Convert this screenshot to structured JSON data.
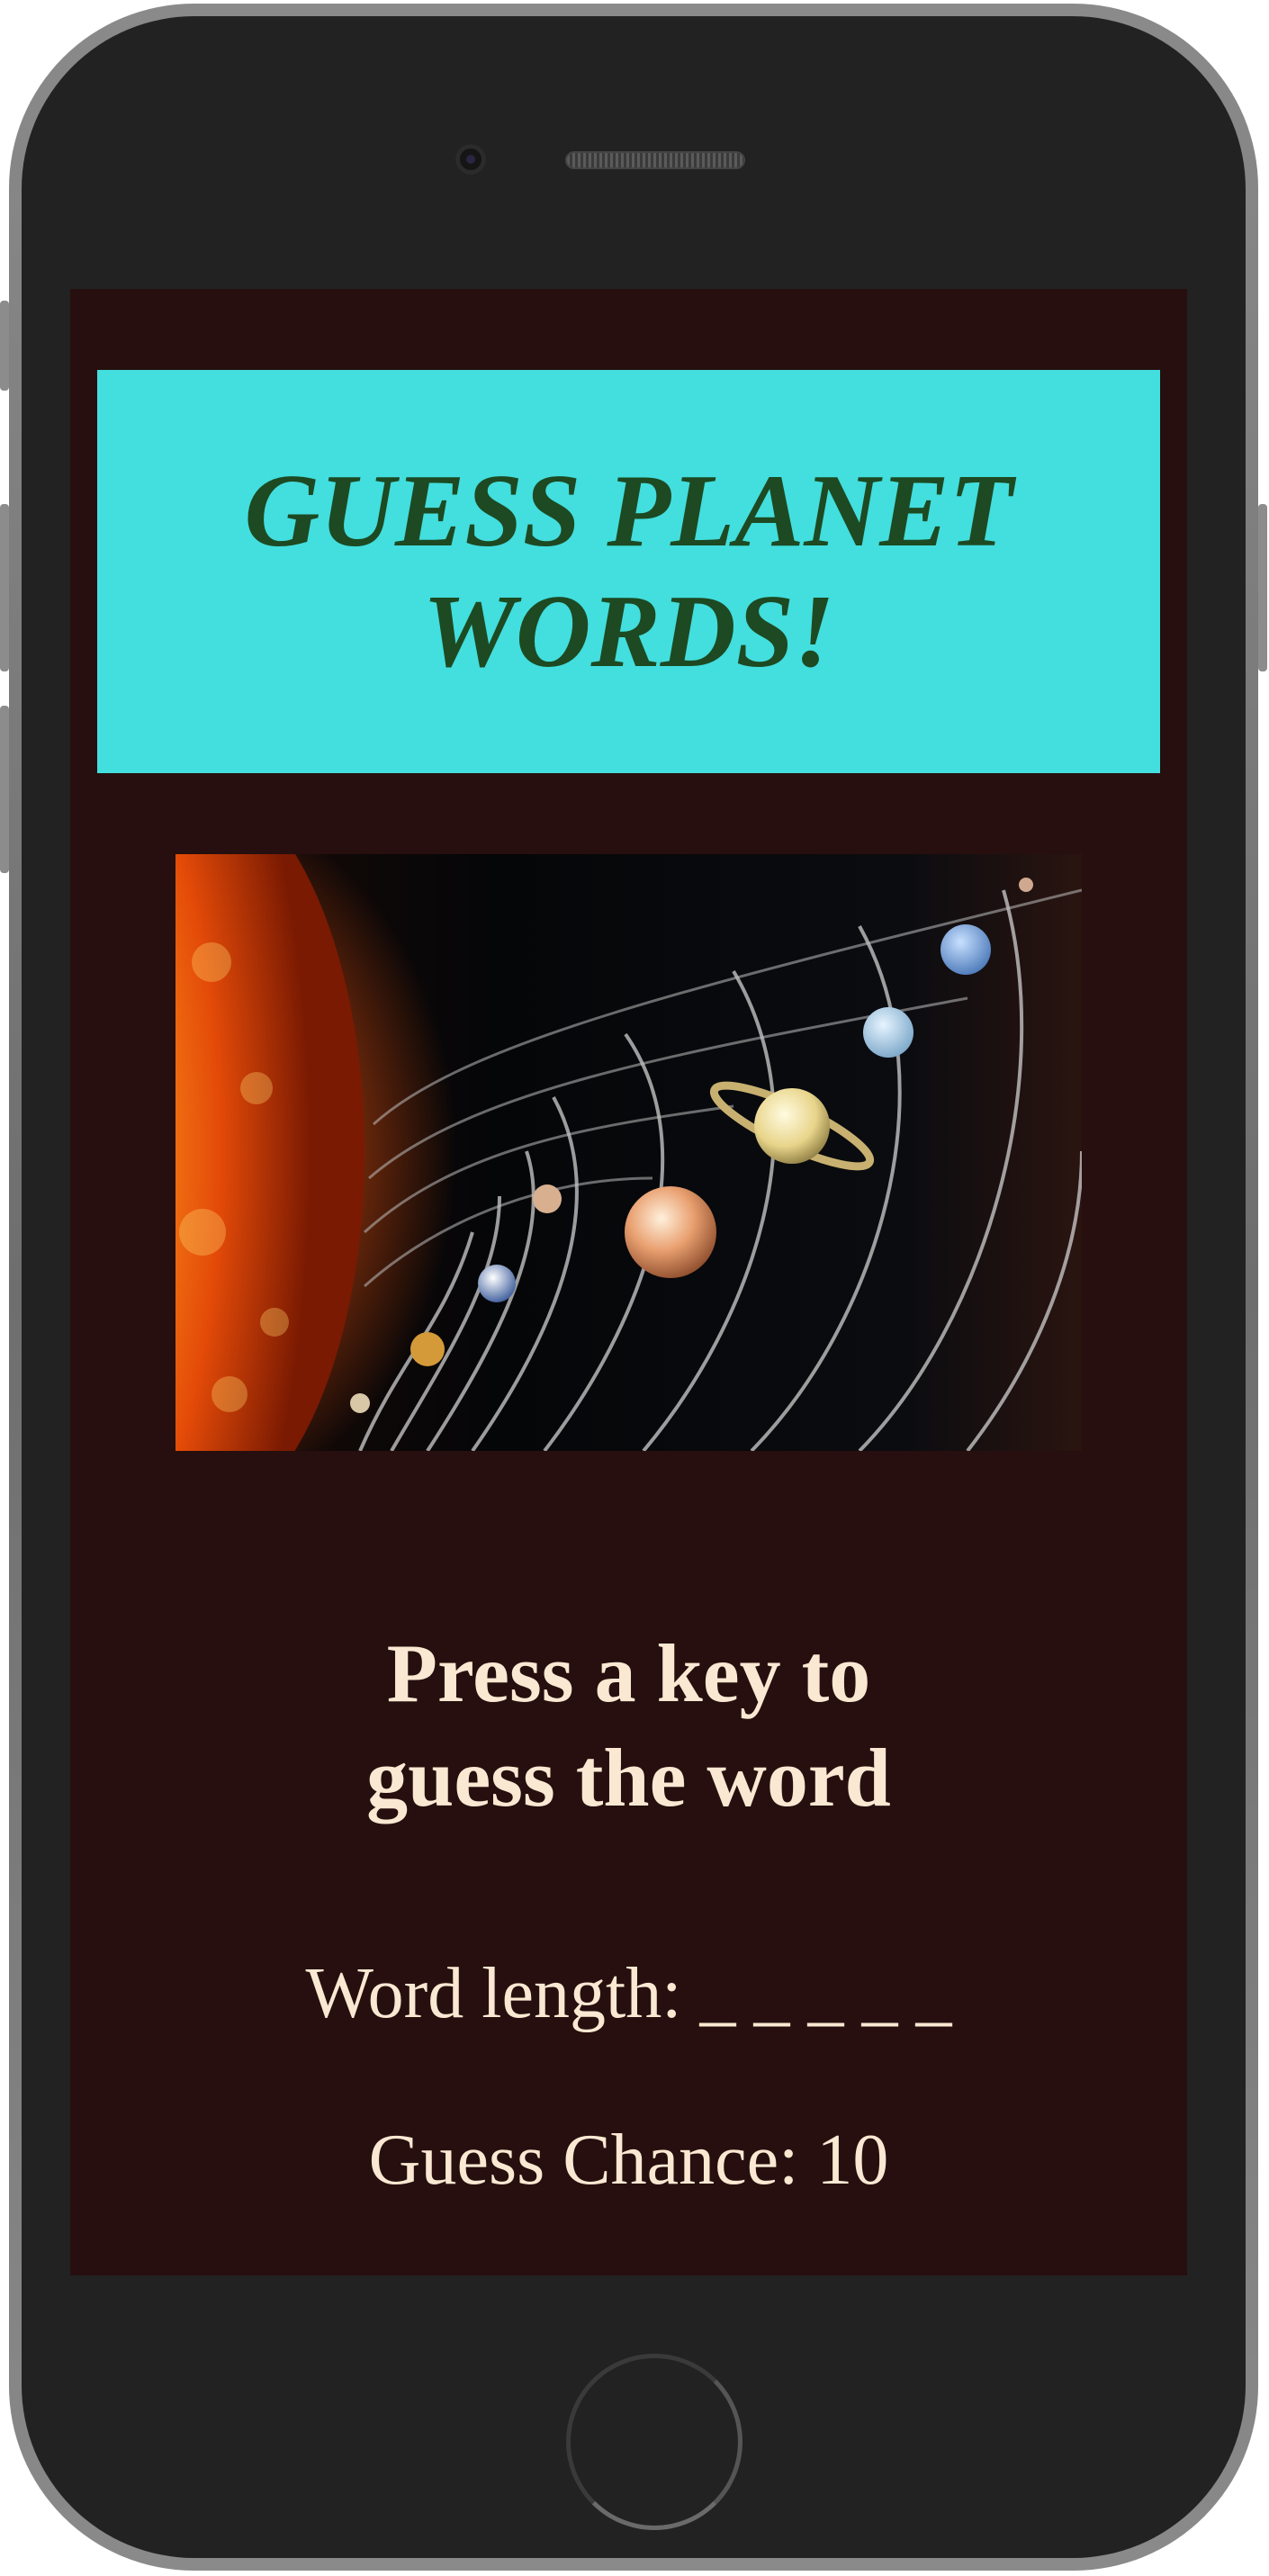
{
  "game": {
    "title": "GUESS PLANET WORDS!",
    "prompt_line1": "Press a key to",
    "prompt_line2": "guess the word",
    "word_length_label": "Word length:",
    "word_length_value": "_ _ _ _ _",
    "guess_chance_label": "Guess Chance:",
    "guess_chance_value": "10"
  },
  "colors": {
    "screen_background": "#260f0e",
    "banner_background": "#43dede",
    "title_text": "#1d4a22",
    "body_text": "#fbe8d2"
  }
}
